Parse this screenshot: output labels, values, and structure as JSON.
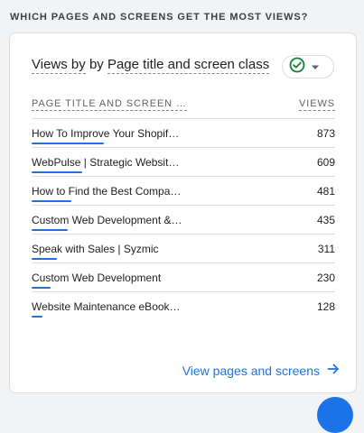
{
  "section": {
    "heading": "WHICH PAGES AND SCREENS GET THE MOST VIEWS?"
  },
  "card": {
    "title_prefix": "Views by",
    "title_dimension": "Page title and screen class",
    "columns": {
      "title": "PAGE TITLE AND SCREEN …",
      "views": "VIEWS"
    },
    "rows": [
      {
        "label": "How To Improve Your Shopif…",
        "value": "873",
        "share": 1.0
      },
      {
        "label": "WebPulse | Strategic Websit…",
        "value": "609",
        "share": 0.698
      },
      {
        "label": "How to Find the Best Compa…",
        "value": "481",
        "share": 0.551
      },
      {
        "label": "Custom Web Development &…",
        "value": "435",
        "share": 0.498
      },
      {
        "label": "Speak with Sales | Syzmic",
        "value": "311",
        "share": 0.356
      },
      {
        "label": "Custom Web Development",
        "value": "230",
        "share": 0.263
      },
      {
        "label": "Website Maintenance eBook…",
        "value": "128",
        "share": 0.147
      }
    ],
    "footer_link": "View pages and screens",
    "colors": {
      "accent": "#1a73e8",
      "success": "#188038"
    }
  }
}
